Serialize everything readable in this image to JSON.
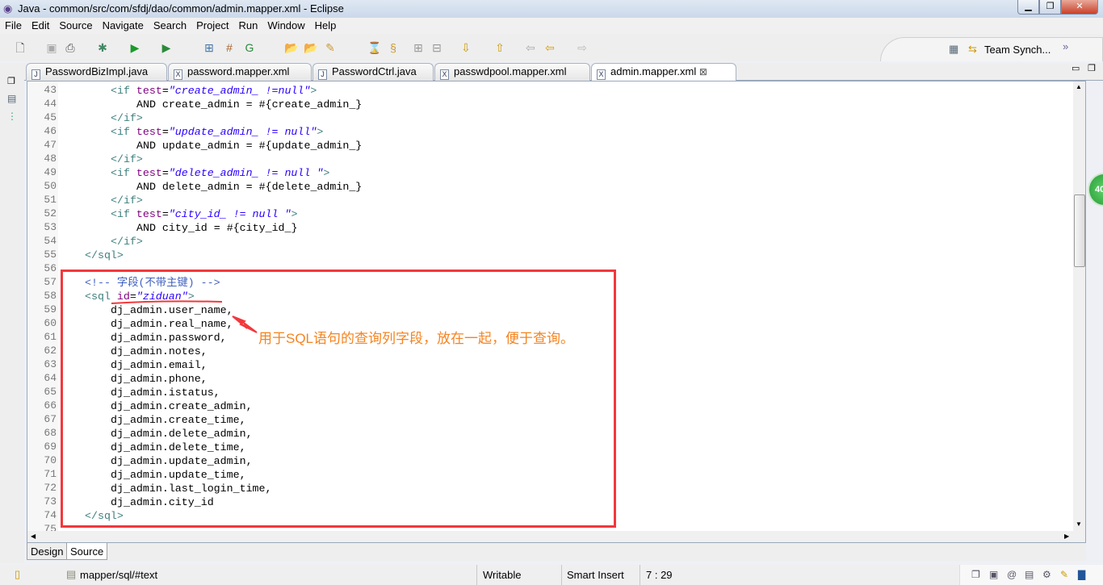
{
  "window": {
    "title": "Java - common/src/com/sfdj/dao/common/admin.mapper.xml - Eclipse",
    "controls": [
      "minimize",
      "restore",
      "close"
    ]
  },
  "menu": [
    "File",
    "Edit",
    "Source",
    "Navigate",
    "Search",
    "Project",
    "Run",
    "Window",
    "Help"
  ],
  "toolbar": {
    "perspectives": {
      "team_sync": "Team Synch...",
      "overflow": "»"
    }
  },
  "tabs": [
    {
      "label": "PasswordBizImpl.java",
      "icon": "J"
    },
    {
      "label": "password.mapper.xml",
      "icon": "X"
    },
    {
      "label": "PasswordCtrl.java",
      "icon": "J"
    },
    {
      "label": "passwdpool.mapper.xml",
      "icon": "X"
    },
    {
      "label": "admin.mapper.xml",
      "icon": "X",
      "active": true,
      "close": "⊠"
    }
  ],
  "editor": {
    "lines": [
      {
        "n": "43",
        "i": 2,
        "s": [
          [
            "tag",
            "<if "
          ],
          [
            "attr",
            "test"
          ],
          [
            "txt",
            "="
          ],
          [
            "val",
            "\"create_admin_ !=null\""
          ],
          [
            "tag",
            ">"
          ]
        ]
      },
      {
        "n": "44",
        "i": 3,
        "s": [
          [
            "txt",
            "AND create_admin = #{create_admin_}"
          ]
        ]
      },
      {
        "n": "45",
        "i": 2,
        "s": [
          [
            "tag",
            "</if>"
          ]
        ]
      },
      {
        "n": "46",
        "i": 2,
        "s": [
          [
            "tag",
            "<if "
          ],
          [
            "attr",
            "test"
          ],
          [
            "txt",
            "="
          ],
          [
            "val",
            "\"update_admin_ != null\""
          ],
          [
            "tag",
            ">"
          ]
        ]
      },
      {
        "n": "47",
        "i": 3,
        "s": [
          [
            "txt",
            "AND update_admin = #{update_admin_}"
          ]
        ]
      },
      {
        "n": "48",
        "i": 2,
        "s": [
          [
            "tag",
            "</if>"
          ]
        ]
      },
      {
        "n": "49",
        "i": 2,
        "s": [
          [
            "tag",
            "<if "
          ],
          [
            "attr",
            "test"
          ],
          [
            "txt",
            "="
          ],
          [
            "val",
            "\"delete_admin_ != null \""
          ],
          [
            "tag",
            ">"
          ]
        ]
      },
      {
        "n": "50",
        "i": 3,
        "s": [
          [
            "txt",
            "AND delete_admin = #{delete_admin_}"
          ]
        ]
      },
      {
        "n": "51",
        "i": 2,
        "s": [
          [
            "tag",
            "</if>"
          ]
        ]
      },
      {
        "n": "52",
        "i": 2,
        "s": [
          [
            "tag",
            "<if "
          ],
          [
            "attr",
            "test"
          ],
          [
            "txt",
            "="
          ],
          [
            "val",
            "\"city_id_ != null \""
          ],
          [
            "tag",
            ">"
          ]
        ]
      },
      {
        "n": "53",
        "i": 3,
        "s": [
          [
            "txt",
            "AND city_id = #{city_id_}"
          ]
        ]
      },
      {
        "n": "54",
        "i": 2,
        "s": [
          [
            "tag",
            "</if>"
          ]
        ]
      },
      {
        "n": "55",
        "i": 1,
        "s": [
          [
            "tag",
            "</sql>"
          ]
        ]
      },
      {
        "n": "56",
        "i": 0,
        "s": []
      },
      {
        "n": "57",
        "i": 1,
        "s": [
          [
            "cmt",
            "<!-- 字段(不带主键) -->"
          ]
        ]
      },
      {
        "n": "58",
        "i": 1,
        "s": [
          [
            "tag",
            "<sql "
          ],
          [
            "attr",
            "id"
          ],
          [
            "txt",
            "="
          ],
          [
            "val",
            "\"ziduan\""
          ],
          [
            "tag",
            ">"
          ]
        ]
      },
      {
        "n": "59",
        "i": 2,
        "s": [
          [
            "txt",
            "dj_admin.user_name,"
          ]
        ]
      },
      {
        "n": "60",
        "i": 2,
        "s": [
          [
            "txt",
            "dj_admin.real_name,"
          ]
        ]
      },
      {
        "n": "61",
        "i": 2,
        "s": [
          [
            "txt",
            "dj_admin.password,"
          ]
        ]
      },
      {
        "n": "62",
        "i": 2,
        "s": [
          [
            "txt",
            "dj_admin.notes,"
          ]
        ]
      },
      {
        "n": "63",
        "i": 2,
        "s": [
          [
            "txt",
            "dj_admin.email,"
          ]
        ]
      },
      {
        "n": "64",
        "i": 2,
        "s": [
          [
            "txt",
            "dj_admin.phone,"
          ]
        ]
      },
      {
        "n": "65",
        "i": 2,
        "s": [
          [
            "txt",
            "dj_admin.istatus,"
          ]
        ]
      },
      {
        "n": "66",
        "i": 2,
        "s": [
          [
            "txt",
            "dj_admin.create_admin,"
          ]
        ]
      },
      {
        "n": "67",
        "i": 2,
        "s": [
          [
            "txt",
            "dj_admin.create_time,"
          ]
        ]
      },
      {
        "n": "68",
        "i": 2,
        "s": [
          [
            "txt",
            "dj_admin.delete_admin,"
          ]
        ]
      },
      {
        "n": "69",
        "i": 2,
        "s": [
          [
            "txt",
            "dj_admin.delete_time,"
          ]
        ]
      },
      {
        "n": "70",
        "i": 2,
        "s": [
          [
            "txt",
            "dj_admin.update_admin,"
          ]
        ]
      },
      {
        "n": "71",
        "i": 2,
        "s": [
          [
            "txt",
            "dj_admin.update_time,"
          ]
        ]
      },
      {
        "n": "72",
        "i": 2,
        "s": [
          [
            "txt",
            "dj_admin.last_login_time,"
          ]
        ]
      },
      {
        "n": "73",
        "i": 2,
        "s": [
          [
            "txt",
            "dj_admin.city_id"
          ]
        ]
      },
      {
        "n": "74",
        "i": 1,
        "s": [
          [
            "tag",
            "</sql>"
          ]
        ]
      },
      {
        "n": "75",
        "i": 0,
        "s": []
      }
    ]
  },
  "annotation": {
    "text": "用于SQL语句的查询列字段，放在一起，便于查询。",
    "color": "#f58420",
    "box_color": "#f2383c"
  },
  "badge": {
    "text": "40",
    "color": "#3cb54a"
  },
  "bottom_tabs": [
    "Design",
    "Source"
  ],
  "status": {
    "path": "mapper/sql/#text",
    "mode": "Writable",
    "insert": "Smart Insert",
    "position": "7 : 29"
  }
}
